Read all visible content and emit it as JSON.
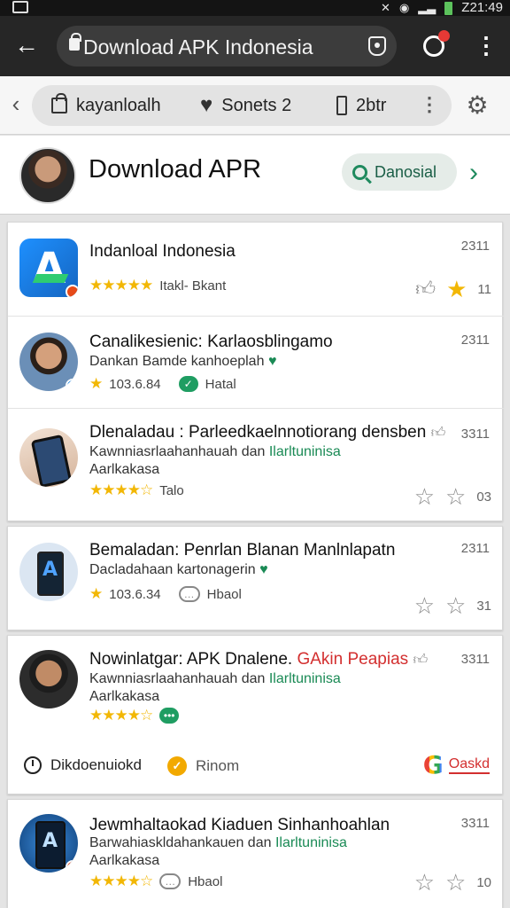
{
  "status_bar": {
    "time": "Z21:49"
  },
  "browser": {
    "url": "Download APK Indonesia"
  },
  "toolbar": {
    "items": [
      {
        "label": "kayanloalh",
        "icon": "bag-icon"
      },
      {
        "label": "Sonets 2",
        "icon": "heart-icon"
      },
      {
        "label": "2btr",
        "icon": "phone-icon"
      }
    ]
  },
  "header": {
    "title": "Download APR",
    "search_label": "Danosial"
  },
  "results": [
    {
      "title": "Indanloal Indonesia",
      "rating_text": "Itakl- Bkant",
      "count": "2311",
      "action_count": "11"
    },
    {
      "title": "Canalikesienic: Karlaosblingamo",
      "subtitle": "Dankan Bamde kanhoeplah",
      "rating_value": "103.6.84",
      "meta": "Hatal",
      "count": "2311"
    },
    {
      "title": "Dlenaladau : Parleedkaelnnotiorang densben",
      "subtitle_a": "Kawnniasrlaahanhauah dan",
      "subtitle_b": "Ilarltuninisa",
      "subtitle_c": "Aarlkakasa",
      "rating_text": "Talo",
      "count": "3311",
      "action_count": "03"
    },
    {
      "title": "Bemaladan: Penrlan Blanan Manlnlapatn",
      "subtitle": "Dacladahaan kartonagerin",
      "rating_value": "103.6.34",
      "meta": "Hbaol",
      "count": "2311",
      "action_count": "31"
    },
    {
      "title_a": "Nowinlatgar: APK Dnalene.",
      "title_b": "GAkin Peapias",
      "subtitle_a": "Kawnniasrlaahanhauah dan",
      "subtitle_b": "Ilarltuninisa",
      "subtitle_c": "Aarlkakasa",
      "count": "3311",
      "footer_left": "Dikdoenuiokd",
      "footer_mid": "Rinom",
      "footer_link": "Oaskd"
    },
    {
      "title": "Jewmhaltaokad Kiaduen Sinhanhoahlan",
      "subtitle_a": "Barwahiaskldahankauen dan",
      "subtitle_b": "Ilarltuninisa",
      "subtitle_c": "Aarlkakasa",
      "meta": "Hbaol",
      "count": "3311",
      "action_count": "10"
    }
  ],
  "colors": {
    "accent_green": "#1f8a5e",
    "star_yellow": "#f2b705",
    "link_red": "#d32f2f"
  }
}
